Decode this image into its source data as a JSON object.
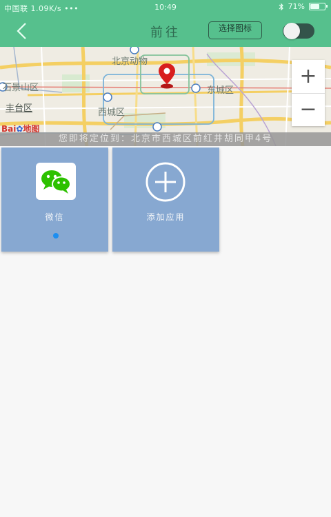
{
  "status_bar": {
    "left": "中国联 1.09K/s •••",
    "time": "10:49",
    "battery": "71%",
    "battery_level": 0.71
  },
  "header": {
    "title": "前往",
    "select_button_label": "选择图标",
    "toggle_on": false
  },
  "map": {
    "labels": [
      "北京动物",
      "石景山区",
      "丰台区",
      "西城区",
      "东城区"
    ],
    "baidu_logo_prefix": "Bai",
    "baidu_logo_suffix": "地图",
    "zoom_in": "+",
    "zoom_out": "−",
    "location_text": "您即将定位到：北京市西城区前红井胡同甲4号"
  },
  "apps": [
    {
      "label": "微信",
      "icon": "wechat-icon",
      "active": true
    },
    {
      "label": "添加应用",
      "icon": "add-circle-icon",
      "active": false
    }
  ],
  "colors": {
    "accent": "#56c08d",
    "tile": "#87a8d1",
    "pin": "#d81e1e",
    "dot": "#1d8ef0"
  }
}
